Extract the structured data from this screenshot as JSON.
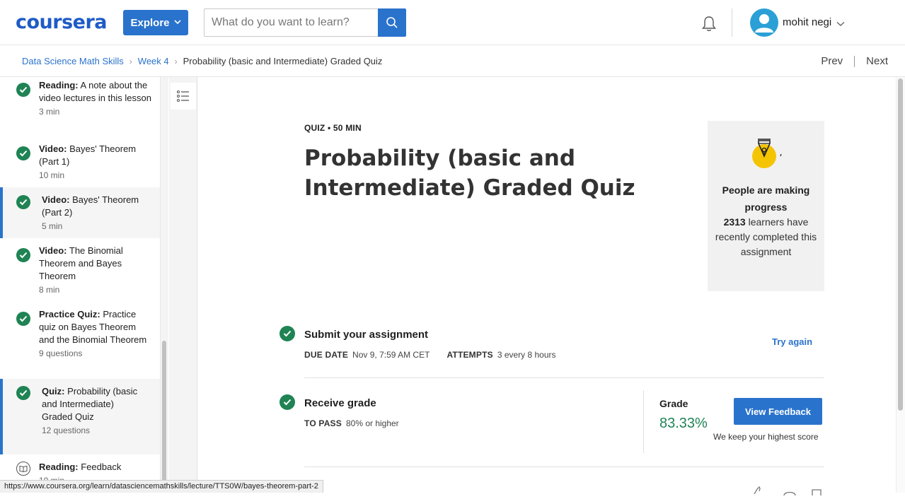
{
  "header": {
    "logo": "coursera",
    "explore_label": "Explore",
    "search_placeholder": "What do you want to learn?",
    "user_name": "mohit negi"
  },
  "breadcrumb": {
    "course": "Data Science Math Skills",
    "week": "Week 4",
    "current": "Probability (basic and Intermediate) Graded Quiz"
  },
  "nav": {
    "prev": "Prev",
    "next": "Next"
  },
  "sidebar": {
    "items": [
      {
        "type": "Reading:",
        "title": "A note about the video lectures in this lesson",
        "meta": "3 min",
        "completed": true,
        "active": false
      },
      {
        "type": "Video:",
        "title": "Bayes' Theorem (Part 1)",
        "meta": "10 min",
        "completed": true,
        "active": false
      },
      {
        "type": "Video:",
        "title": "Bayes' Theorem (Part 2)",
        "meta": "5 min",
        "completed": true,
        "active": true
      },
      {
        "type": "Video:",
        "title": "The Binomial Theorem and Bayes Theorem",
        "meta": "8 min",
        "completed": true,
        "active": false
      },
      {
        "type": "Practice Quiz:",
        "title": "Practice quiz on Bayes Theorem and the Binomial Theorem",
        "meta": "9 questions",
        "completed": true,
        "active": false
      },
      {
        "type": "Quiz:",
        "title": "Probability (basic and Intermediate) Graded Quiz",
        "meta": "12 questions",
        "completed": true,
        "active": true
      },
      {
        "type": "Reading:",
        "title": "Feedback",
        "meta": "10 min",
        "completed": false,
        "active": false
      }
    ]
  },
  "quiz": {
    "meta": "QUIZ • 50 MIN",
    "title": "Probability (basic and Intermediate) Graded Quiz"
  },
  "progress_card": {
    "heading": "People are making progress",
    "count": "2313",
    "text": "learners have recently completed this assignment"
  },
  "submit": {
    "title": "Submit your assignment",
    "due_label": "DUE DATE",
    "due_value": "Nov 9, 7:59 AM CET",
    "attempts_label": "ATTEMPTS",
    "attempts_value": "3 every 8 hours",
    "try_again": "Try again"
  },
  "receive": {
    "title": "Receive grade",
    "pass_label": "TO PASS",
    "pass_value": "80% or higher",
    "grade_label": "Grade",
    "grade_value": "83.33%",
    "view_feedback": "View Feedback",
    "keep_note": "We keep your highest score"
  },
  "status_bar": {
    "url": "https://www.coursera.org/learn/datasciencemathskills/lecture/TTS0W/bayes-theorem-part-2"
  },
  "colors": {
    "brand_blue": "#2a73cc",
    "success_green": "#1f8354",
    "avatar_blue": "#2aa0d6",
    "badge_yellow": "#f5c400"
  }
}
